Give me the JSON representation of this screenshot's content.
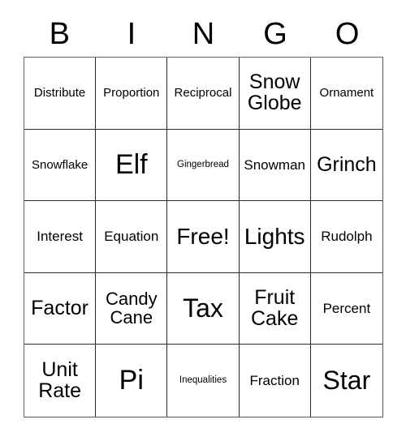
{
  "card": {
    "title_letters": [
      "B",
      "I",
      "N",
      "G",
      "O"
    ],
    "background_color": "#ffffff",
    "text_color": "#000000",
    "grid_line_color": "#2b2b2b",
    "rows": 5,
    "columns": 5,
    "cells": [
      [
        {
          "label": "Distribute",
          "size": "sm",
          "free": false
        },
        {
          "label": "Proportion",
          "size": "sm",
          "free": false
        },
        {
          "label": "Reciprocal",
          "size": "sm",
          "free": false
        },
        {
          "label": "Snow\nGlobe",
          "size": "xl",
          "free": false
        },
        {
          "label": "Ornament",
          "size": "sm",
          "free": false
        }
      ],
      [
        {
          "label": "Snowflake",
          "size": "sm",
          "free": false
        },
        {
          "label": "Elf",
          "size": "4xl",
          "free": false
        },
        {
          "label": "Gingerbread",
          "size": "xs",
          "free": false
        },
        {
          "label": "Snowman",
          "size": "md",
          "free": false
        },
        {
          "label": "Grinch",
          "size": "xl",
          "free": false
        }
      ],
      [
        {
          "label": "Interest",
          "size": "md",
          "free": false
        },
        {
          "label": "Equation",
          "size": "md",
          "free": false
        },
        {
          "label": "Free!",
          "size": "2xl",
          "free": true
        },
        {
          "label": "Lights",
          "size": "2xl",
          "free": false
        },
        {
          "label": "Rudolph",
          "size": "md",
          "free": false
        }
      ],
      [
        {
          "label": "Factor",
          "size": "xl",
          "free": false
        },
        {
          "label": "Candy\nCane",
          "size": "lg",
          "free": false
        },
        {
          "label": "Tax",
          "size": "3xl",
          "free": false
        },
        {
          "label": "Fruit\nCake",
          "size": "xl",
          "free": false
        },
        {
          "label": "Percent",
          "size": "md",
          "free": false
        }
      ],
      [
        {
          "label": "Unit\nRate",
          "size": "xl",
          "free": false
        },
        {
          "label": "Pi",
          "size": "4xl",
          "free": false
        },
        {
          "label": "Inequalities",
          "size": "xs",
          "free": false
        },
        {
          "label": "Fraction",
          "size": "md",
          "free": false
        },
        {
          "label": "Star",
          "size": "3xl",
          "free": false
        }
      ]
    ]
  }
}
